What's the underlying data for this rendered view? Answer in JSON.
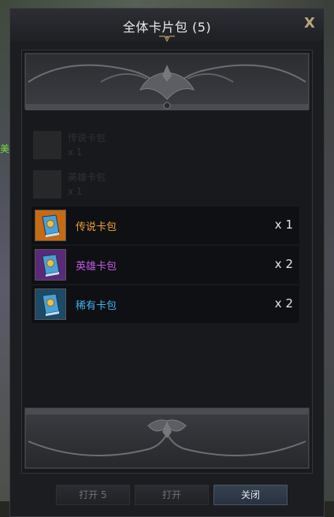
{
  "window": {
    "title": "全体卡片包 (5)",
    "close_label": "X"
  },
  "ghost_items": [
    {
      "name": "传说卡包",
      "qty": "x 1"
    },
    {
      "name": "英雄卡包",
      "qty": "x 1"
    }
  ],
  "items": [
    {
      "name": "传说卡包",
      "qty": "x 1",
      "color": "#f0a33a",
      "icon_bg": "#c76a14"
    },
    {
      "name": "英雄卡包",
      "qty": "x 2",
      "color": "#c35ae8",
      "icon_bg": "#5a2a78"
    },
    {
      "name": "稀有卡包",
      "qty": "x 2",
      "color": "#3fb3f0",
      "icon_bg": "#1d4a66"
    }
  ],
  "buttons": {
    "open5": "打开 5",
    "open": "打开",
    "close": "关闭"
  },
  "background": {
    "side_text": "美"
  }
}
